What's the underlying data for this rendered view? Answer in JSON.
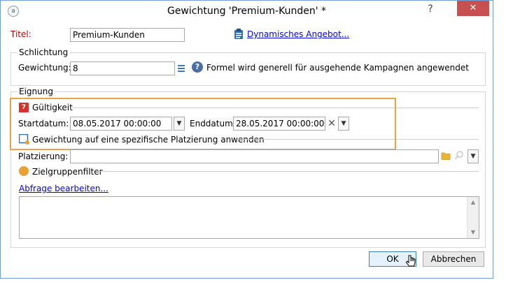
{
  "window": {
    "title": "Gewichtung 'Premium-Kunden' *",
    "help_label": "?",
    "close_label": "✕",
    "app_icon_label": "a"
  },
  "titel": {
    "label": "Titel:",
    "value": "Premium-Kunden"
  },
  "dynamic_offer_link": "Dynamisches Angebot...",
  "schlichtung": {
    "group_title": "Schlichtung",
    "gewichtung_label": "Gewichtung:",
    "gewichtung_value": "8",
    "hint": "Formel wird generell für ausgehende Kampagnen angewendet"
  },
  "eignung": {
    "group_title": "Eignung",
    "gueltigkeit_label": "Gültigkeit",
    "calendar_day": "7",
    "startdatum_label": "Startdatum:",
    "startdatum_value": "08.05.2017 00:00:00",
    "enddatum_label": "Enddatum:",
    "enddatum_value": "28.05.2017 00:00:00",
    "placement_checkbox_label": "Gewichtung auf eine spezifische Platzierung anwenden",
    "platzierung_label": "Platzierung:",
    "platzierung_value": "",
    "zielgruppenfilter_label": "Zielgruppenfilter",
    "edit_query_link": "Abfrage bearbeiten..."
  },
  "buttons": {
    "ok": "OK",
    "cancel": "Abbrechen"
  },
  "colors": {
    "highlight_border": "#f0a044",
    "close_button": "#c75050",
    "link": "#0000ee",
    "title_label": "#c00000"
  }
}
